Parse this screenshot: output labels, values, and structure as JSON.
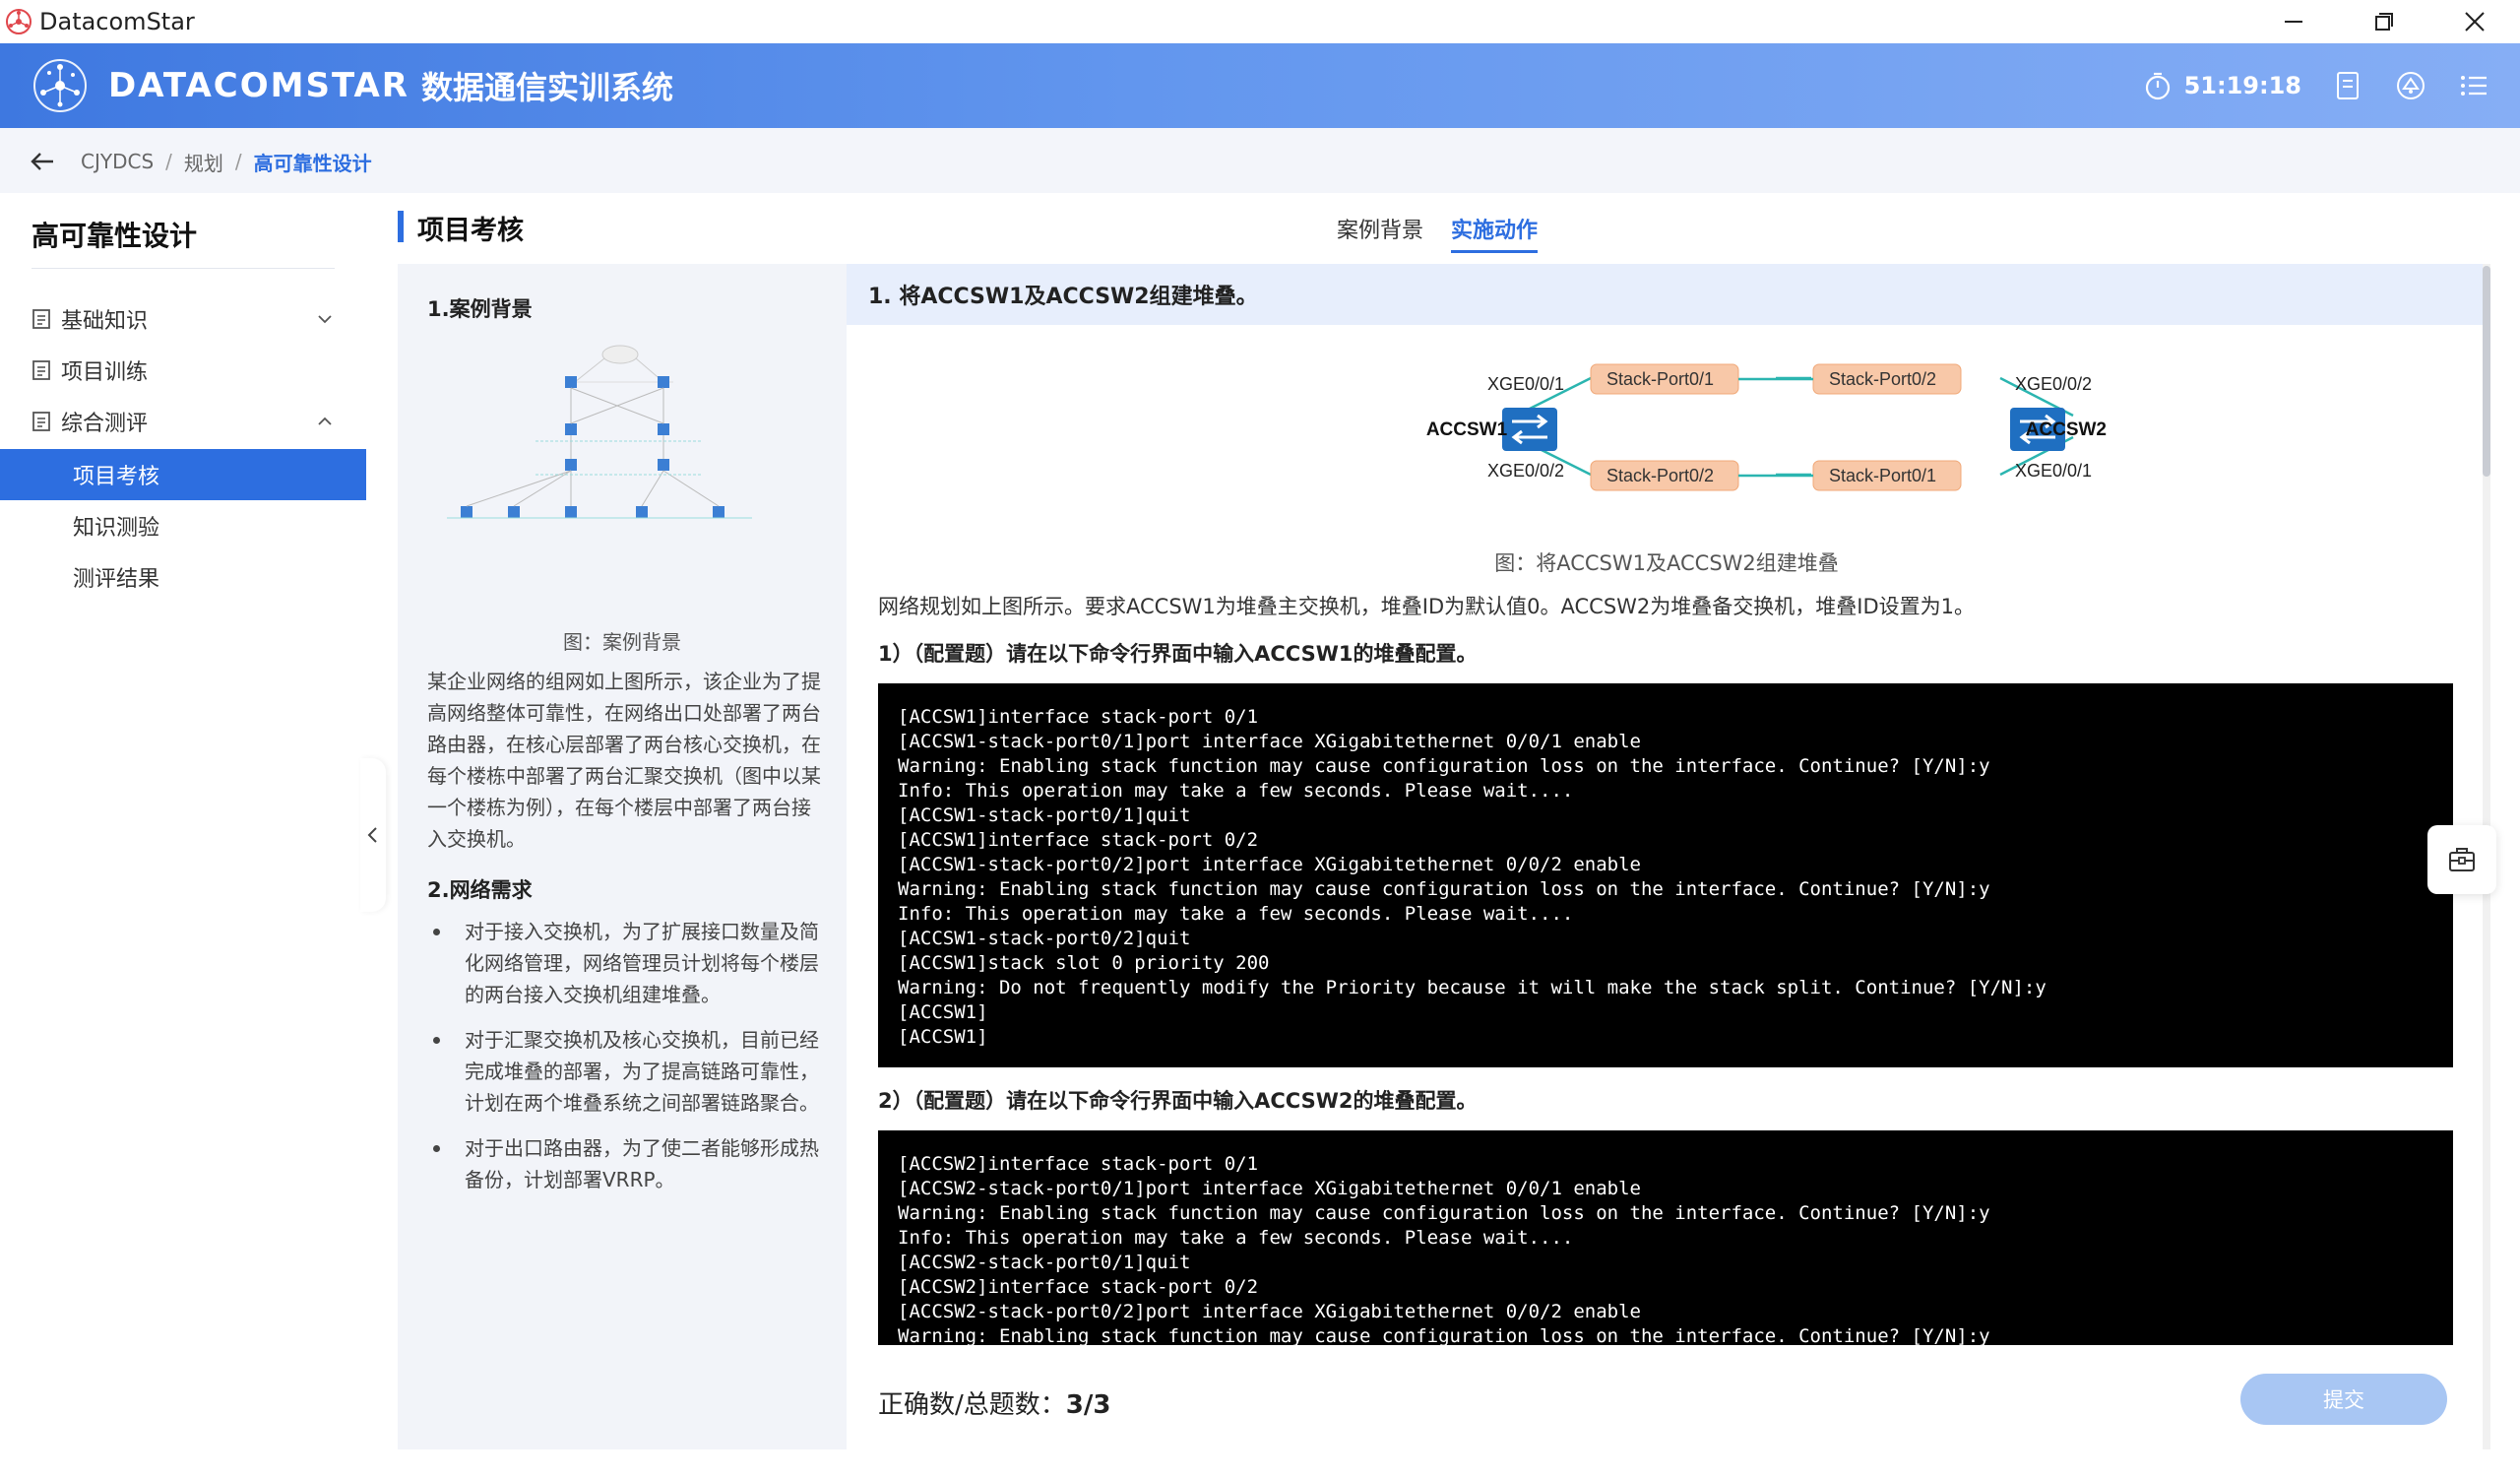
{
  "window": {
    "app_name": "DatacomStar",
    "controls": [
      "minimize-icon",
      "restore-icon",
      "close-icon"
    ]
  },
  "header": {
    "brand": "DATACOMSTAR",
    "subtitle": "数据通信实训系统",
    "timer": "51:19:18",
    "icons": [
      "timer-icon",
      "notes-icon",
      "assistant-icon",
      "menu-icon"
    ]
  },
  "breadcrumb": {
    "items": [
      "CJYDCS",
      "规划",
      "高可靠性设计"
    ],
    "separator": "/"
  },
  "sidebar": {
    "title": "高可靠性设计",
    "items": [
      {
        "label": "基础知识",
        "expandable": true,
        "expanded": false
      },
      {
        "label": "项目训练",
        "expandable": false
      },
      {
        "label": "综合测评",
        "expandable": true,
        "expanded": true
      },
      {
        "label": "项目考核",
        "active": true
      },
      {
        "label": "知识测验"
      },
      {
        "label": "测评结果"
      }
    ]
  },
  "main": {
    "section_title": "项目考核",
    "tabs": [
      {
        "label": "案例背景",
        "active": false
      },
      {
        "label": "实施动作",
        "active": true
      }
    ]
  },
  "case": {
    "heading1": "1.案例背景",
    "figure_caption": "图：案例背景",
    "paragraph": "某企业网络的组网如上图所示，该企业为了提高网络整体可靠性，在网络出口处部署了两台路由器，在核心层部署了两台核心交换机，在每个楼栋中部署了两台汇聚交换机（图中以某一个楼栋为例），在每个楼层中部署了两台接入交换机。",
    "heading2": "2.网络需求",
    "requirements": [
      "对于接入交换机，为了扩展接口数量及简化网络管理，网络管理员计划将每个楼层的两台接入交换机组建堆叠。",
      "对于汇聚交换机及核心交换机，目前已经完成堆叠的部署，为了提高链路可靠性，计划在两个堆叠系统之间部署链路聚合。",
      "对于出口路由器，为了使二者能够形成热备份，计划部署VRRP。"
    ]
  },
  "task": {
    "title": "1. 将ACCSW1及ACCSW2组建堆叠。",
    "diagram": {
      "left_switch": "ACCSW1",
      "right_switch": "ACCSW2",
      "left_top_port": "XGE0/0/1",
      "left_bottom_port": "XGE0/0/2",
      "right_top_port": "XGE0/0/2",
      "right_bottom_port": "XGE0/0/1",
      "top_left_stack": "Stack-Port0/1",
      "top_right_stack": "Stack-Port0/2",
      "bottom_left_stack": "Stack-Port0/2",
      "bottom_right_stack": "Stack-Port0/1"
    },
    "figure_caption": "图：将ACCSW1及ACCSW2组建堆叠",
    "description": "网络规划如上图所示。要求ACCSW1为堆叠主交换机，堆叠ID为默认值0。ACCSW2为堆叠备交换机，堆叠ID设置为1。",
    "q1": "1）（配置题）请在以下命令行界面中输入ACCSW1的堆叠配置。",
    "q1_lines": [
      "[ACCSW1]interface stack-port 0/1",
      "[ACCSW1-stack-port0/1]port interface XGigabitethernet 0/0/1 enable",
      "Warning: Enabling stack function may cause configuration loss on the interface. Continue? [Y/N]:y",
      "Info: This operation may take a few seconds. Please wait....",
      "[ACCSW1-stack-port0/1]quit",
      "[ACCSW1]interface stack-port 0/2",
      "[ACCSW1-stack-port0/2]port interface XGigabitethernet 0/0/2 enable",
      "Warning: Enabling stack function may cause configuration loss on the interface. Continue? [Y/N]:y",
      "Info: This operation may take a few seconds. Please wait....",
      "[ACCSW1-stack-port0/2]quit",
      "[ACCSW1]stack slot 0 priority 200",
      "Warning: Do not frequently modify the Priority because it will make the stack split. Continue? [Y/N]:y",
      "[ACCSW1]",
      "[ACCSW1]"
    ],
    "q2": "2）（配置题）请在以下命令行界面中输入ACCSW2的堆叠配置。",
    "q2_lines": [
      "[ACCSW2]interface stack-port 0/1",
      "[ACCSW2-stack-port0/1]port interface XGigabitethernet 0/0/1 enable",
      "Warning: Enabling stack function may cause configuration loss on the interface. Continue? [Y/N]:y",
      "Info: This operation may take a few seconds. Please wait....",
      "[ACCSW2-stack-port0/1]quit",
      "[ACCSW2]interface stack-port 0/2",
      "[ACCSW2-stack-port0/2]port interface XGigabitethernet 0/0/2 enable",
      "Warning: Enabling stack function may cause configuration loss on the interface. Continue? [Y/N]:y"
    ]
  },
  "footer": {
    "score_label": "正确数/总题数：",
    "score_value": "3/3",
    "submit_label": "提交"
  },
  "colors": {
    "accent": "#2d6ee0",
    "header_start": "#3e78e0",
    "header_end": "#86aef5",
    "stack_port": "#f8c8a8",
    "link": "#2bb5b0",
    "submit_disabled": "#a8c6f3"
  }
}
